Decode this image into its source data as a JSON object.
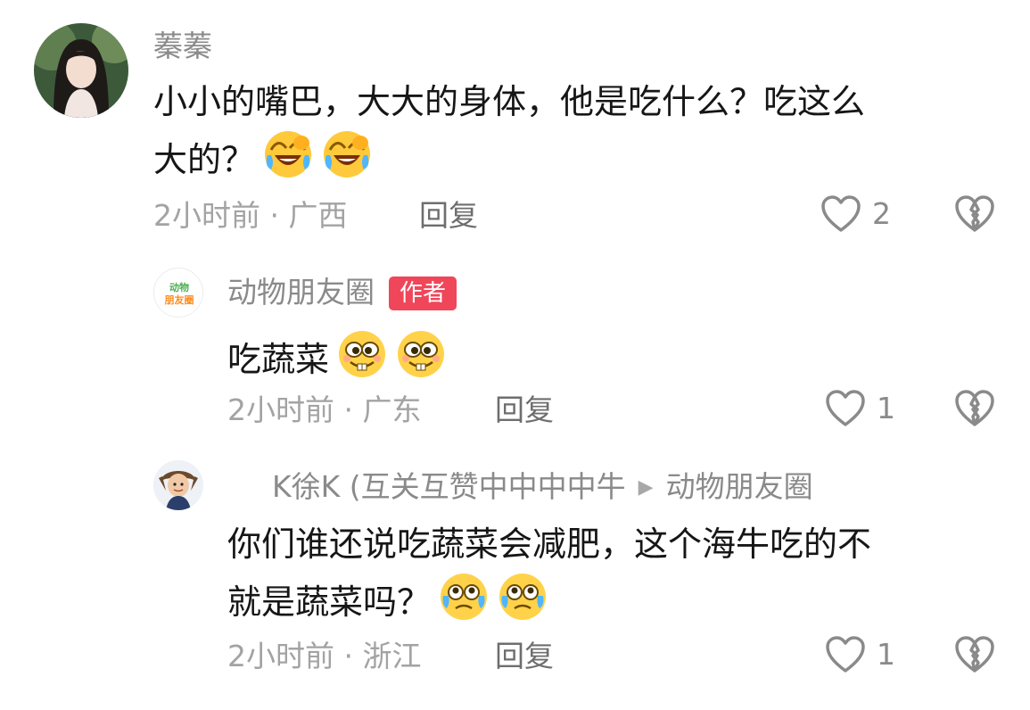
{
  "comments": [
    {
      "username": "蓁蓁",
      "text_line1": "小小的嘴巴，大大的身体，他是吃什么？吃这么",
      "text_line2": "大的？",
      "time_location": "2小时前 · 广西",
      "reply_label": "回复",
      "like_count": "2",
      "emoji": "laugh-cry-emoji"
    },
    {
      "username": "动物朋友圈",
      "badge": "作者",
      "avatar_text": "动物朋友圈",
      "text_line1": "吃蔬菜",
      "time_location": "2小时前 · 广东",
      "reply_label": "回复",
      "like_count": "1",
      "emoji": "buck-tooth-emoji"
    },
    {
      "username": "K徐K (互关互赞中中中中牛",
      "reply_to": "动物朋友圈",
      "text_line1": "你们谁还说吃蔬菜会减肥，这个海牛吃的不",
      "text_line2": "就是蔬菜吗？",
      "time_location": "2小时前 · 浙江",
      "reply_label": "回复",
      "like_count": "1",
      "emoji": "teary-emoji"
    }
  ],
  "colors": {
    "badge": "#f0465a",
    "username": "#8a8a8a",
    "meta": "#a3a3a3"
  }
}
